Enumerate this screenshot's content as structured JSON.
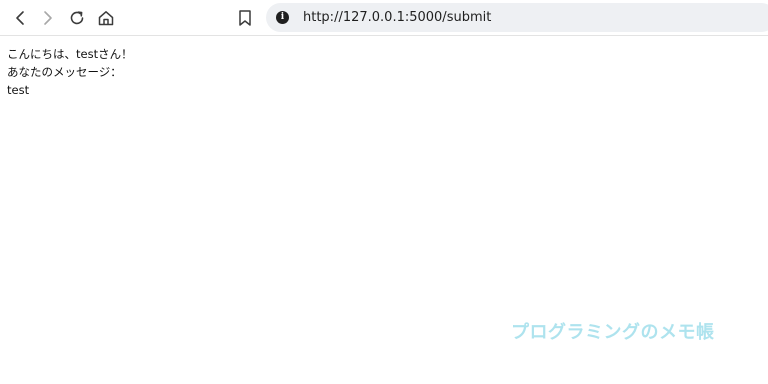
{
  "browser": {
    "url": "http://127.0.0.1:5000/submit",
    "icons": [
      "back-icon",
      "forward-icon",
      "reload-icon",
      "home-icon",
      "bookmark-icon",
      "site-info-icon"
    ],
    "site_info_glyph": "i"
  },
  "page": {
    "greeting": "こんにちは、testさん！",
    "message_label": "あなたのメッセージ：",
    "message_value": "test"
  },
  "watermark": {
    "text": "プログラミングのメモ帳",
    "color": "#aee3ee"
  }
}
